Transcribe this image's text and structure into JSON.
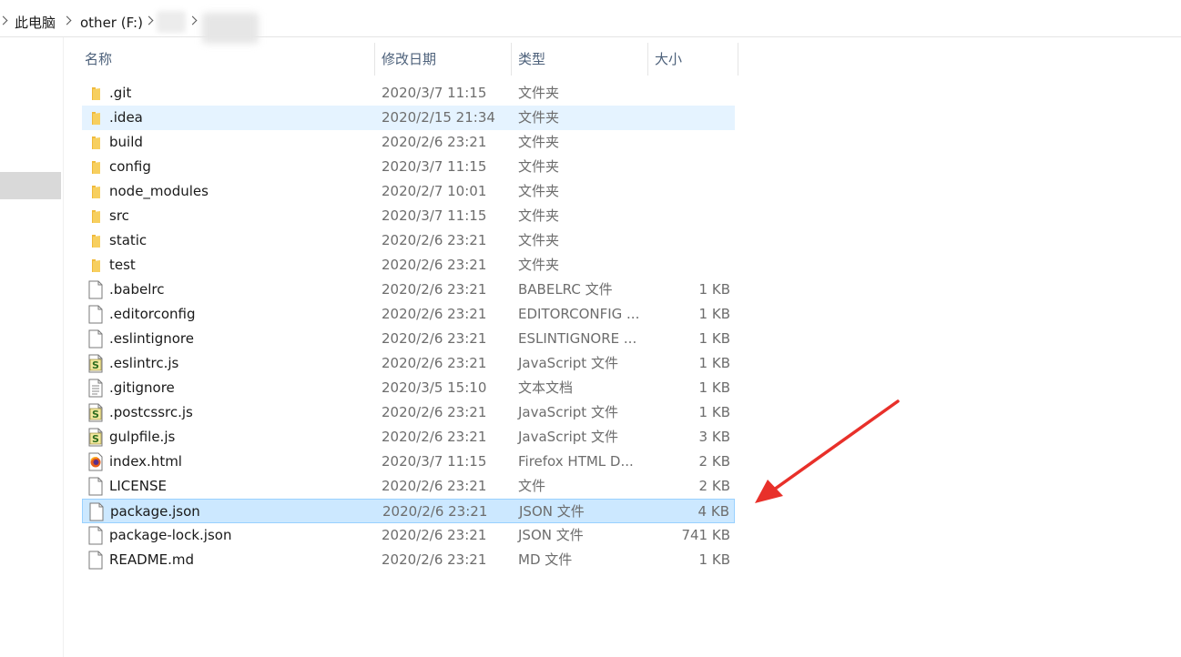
{
  "breadcrumb": {
    "items": [
      "此电脑",
      "other (F:)"
    ]
  },
  "columns": {
    "name": "名称",
    "date": "修改日期",
    "type": "类型",
    "size": "大小"
  },
  "files": [
    {
      "name": ".git",
      "date": "2020/3/7 11:15",
      "type": "文件夹",
      "size": "",
      "icon": "folder-icon"
    },
    {
      "name": ".idea",
      "date": "2020/2/15 21:34",
      "type": "文件夹",
      "size": "",
      "icon": "folder-icon",
      "state": "hover"
    },
    {
      "name": "build",
      "date": "2020/2/6 23:21",
      "type": "文件夹",
      "size": "",
      "icon": "folder-icon"
    },
    {
      "name": "config",
      "date": "2020/3/7 11:15",
      "type": "文件夹",
      "size": "",
      "icon": "folder-icon"
    },
    {
      "name": "node_modules",
      "date": "2020/2/7 10:01",
      "type": "文件夹",
      "size": "",
      "icon": "folder-icon"
    },
    {
      "name": "src",
      "date": "2020/3/7 11:15",
      "type": "文件夹",
      "size": "",
      "icon": "folder-icon"
    },
    {
      "name": "static",
      "date": "2020/2/6 23:21",
      "type": "文件夹",
      "size": "",
      "icon": "folder-icon"
    },
    {
      "name": "test",
      "date": "2020/2/6 23:21",
      "type": "文件夹",
      "size": "",
      "icon": "folder-icon"
    },
    {
      "name": ".babelrc",
      "date": "2020/2/6 23:21",
      "type": "BABELRC 文件",
      "size": "1 KB",
      "icon": "file-icon"
    },
    {
      "name": ".editorconfig",
      "date": "2020/2/6 23:21",
      "type": "EDITORCONFIG ...",
      "size": "1 KB",
      "icon": "file-icon"
    },
    {
      "name": ".eslintignore",
      "date": "2020/2/6 23:21",
      "type": "ESLINTIGNORE ...",
      "size": "1 KB",
      "icon": "file-icon"
    },
    {
      "name": ".eslintrc.js",
      "date": "2020/2/6 23:21",
      "type": "JavaScript 文件",
      "size": "1 KB",
      "icon": "js-file-icon"
    },
    {
      "name": ".gitignore",
      "date": "2020/3/5 15:10",
      "type": "文本文档",
      "size": "1 KB",
      "icon": "text-file-icon"
    },
    {
      "name": ".postcssrc.js",
      "date": "2020/2/6 23:21",
      "type": "JavaScript 文件",
      "size": "1 KB",
      "icon": "js-file-icon"
    },
    {
      "name": "gulpfile.js",
      "date": "2020/2/6 23:21",
      "type": "JavaScript 文件",
      "size": "3 KB",
      "icon": "js-file-icon"
    },
    {
      "name": "index.html",
      "date": "2020/3/7 11:15",
      "type": "Firefox HTML D...",
      "size": "2 KB",
      "icon": "firefox-html-icon"
    },
    {
      "name": "LICENSE",
      "date": "2020/2/6 23:21",
      "type": "文件",
      "size": "2 KB",
      "icon": "file-icon"
    },
    {
      "name": "package.json",
      "date": "2020/2/6 23:21",
      "type": "JSON 文件",
      "size": "4 KB",
      "icon": "file-icon",
      "state": "selected"
    },
    {
      "name": "package-lock.json",
      "date": "2020/2/6 23:21",
      "type": "JSON 文件",
      "size": "741 KB",
      "icon": "file-icon"
    },
    {
      "name": "README.md",
      "date": "2020/2/6 23:21",
      "type": "MD 文件",
      "size": "1 KB",
      "icon": "file-icon"
    }
  ],
  "colors": {
    "hover": "#e5f3ff",
    "selected": "#cce8ff",
    "selected_border": "#99d1ff",
    "folder": "#f5c74f",
    "arrow": "#e8302a",
    "header_text": "#4c607a"
  }
}
